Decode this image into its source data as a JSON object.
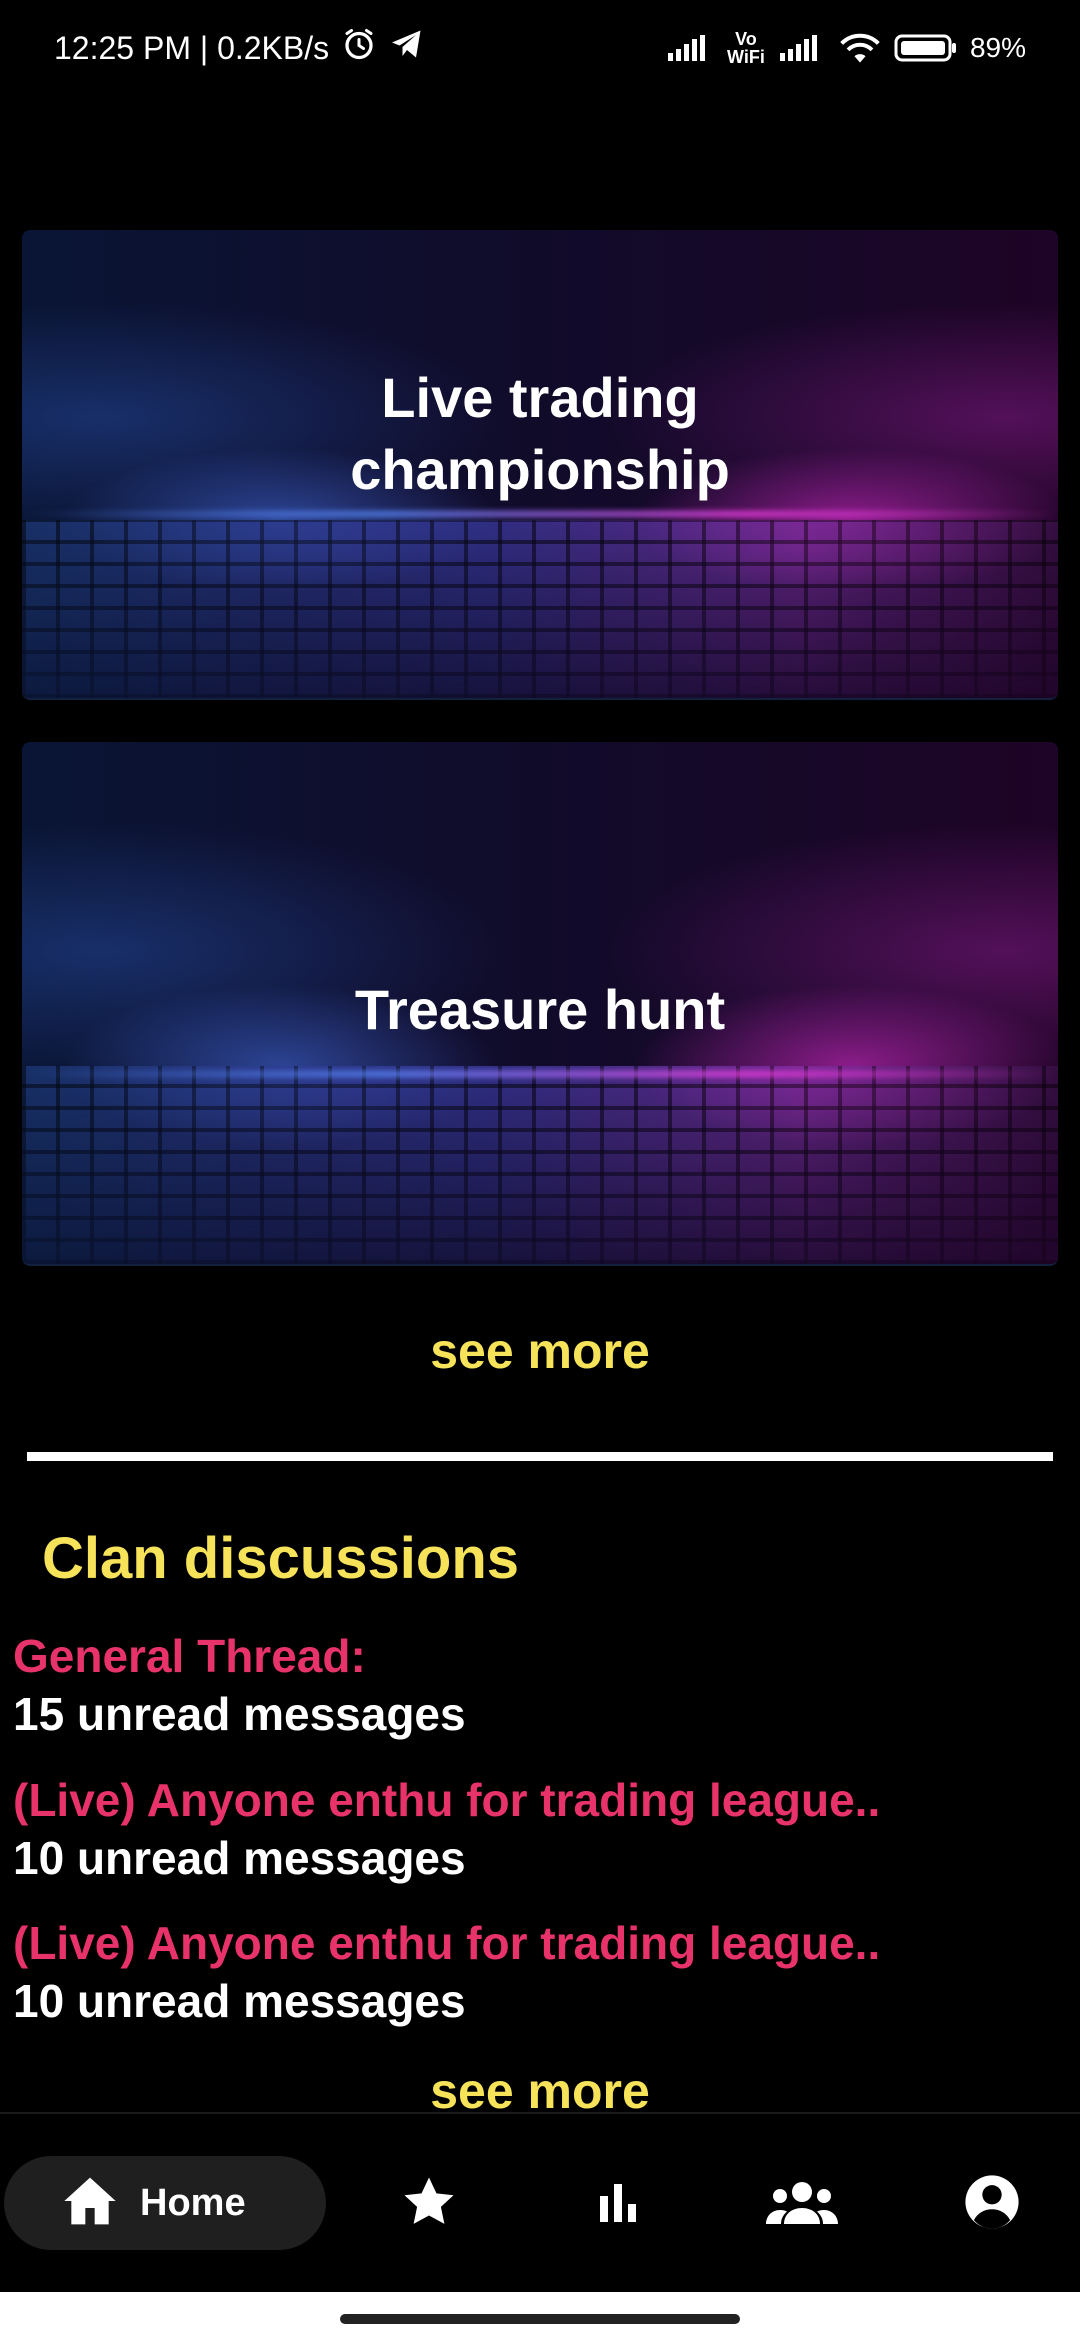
{
  "status_bar": {
    "time_speed": "12:25 PM | 0.2KB/s",
    "vowifi": "Vo WiFi",
    "battery": "89%"
  },
  "events": [
    {
      "title_line1": "Live trading",
      "title_line2": "championship"
    },
    {
      "title": "Treasure hunt"
    }
  ],
  "events_see_more": "see more",
  "clan": {
    "title": "Clan discussions",
    "threads": [
      {
        "title": "General Thread:",
        "unread": "15 unread messages"
      },
      {
        "title": "(Live) Anyone enthu for trading league..",
        "unread": "10 unread messages"
      },
      {
        "title": "(Live) Anyone enthu for trading league..",
        "unread": "10 unread messages"
      }
    ],
    "see_more": "see more"
  },
  "bottom_nav": {
    "home_label": "Home",
    "items": [
      "home-icon",
      "star-icon",
      "leaderboard-icon",
      "clan-icon",
      "profile-icon"
    ]
  },
  "colors": {
    "accent_yellow": "#f6e35a",
    "thread_pink": "#e8336a",
    "background": "#000000"
  }
}
